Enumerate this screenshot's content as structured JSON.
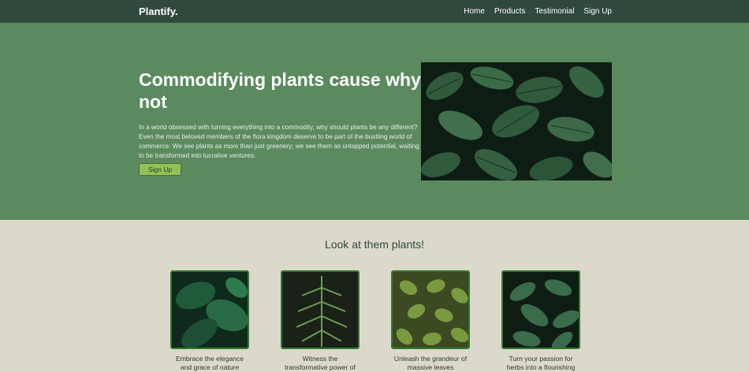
{
  "nav": {
    "brand": "Plantify.",
    "links": [
      "Home",
      "Products",
      "Testimonial",
      "Sign Up"
    ]
  },
  "hero": {
    "title": "Commodifying plants cause why not",
    "text": "In a world obsessed with turning everything into a commodity, why should plants be any different? Even the most beloved members of the flora kingdom deserve to be part of the bustling world of commerce. We see plants as more than just greenery; we see them as untapped potential, waiting to be transformed into lucrative ventures.",
    "button": "Sign Up"
  },
  "section": {
    "title": "Look at them plants!",
    "cards": [
      {
        "caption": "Embrace the elegance and grace of nature"
      },
      {
        "caption": "Witness the transformative power of"
      },
      {
        "caption": "Unleash the grandeur of massive leaves"
      },
      {
        "caption": "Turn your passion for herbs into a flourishing"
      }
    ]
  },
  "colors": {
    "nav_bg": "#2f4a3d",
    "hero_bg": "#5b8a5e",
    "page_bg": "#dcd8cc",
    "button_bg": "#94c05a",
    "card_border": "#2f7a2f"
  }
}
